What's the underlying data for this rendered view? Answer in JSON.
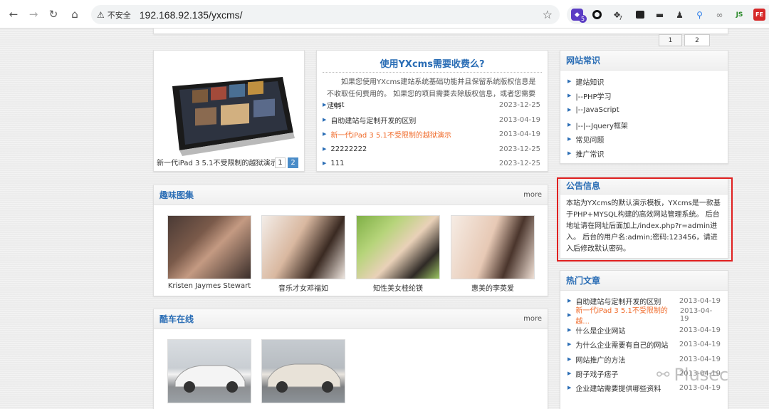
{
  "browser": {
    "security_label": "不安全",
    "url": "192.168.92.135/yxcms/",
    "extensions": [
      {
        "icon": "shield-ext-icon",
        "badge": "5"
      },
      {
        "icon": "ring-ext-icon"
      },
      {
        "icon": "code-ext-icon",
        "badge": "7"
      },
      {
        "icon": "panel-ext-icon"
      },
      {
        "icon": "hat-ext-icon"
      },
      {
        "icon": "spy-ext-icon"
      },
      {
        "icon": "pin-ext-icon"
      },
      {
        "icon": "link-ext-icon"
      },
      {
        "icon": "js-ext-icon",
        "label": "JS"
      },
      {
        "icon": "fe-ext-icon",
        "label": "FE"
      }
    ]
  },
  "pager": [
    "1",
    "2"
  ],
  "slideshow": {
    "caption": "新一代iPad 3 5.1不受限制的越狱演示",
    "pages": [
      "1",
      "2"
    ]
  },
  "feature": {
    "title": "使用YXcms需要收费么?",
    "desc": "如果您使用YXcms建站系统基础功能并且保留系统版权信息是不收取任何费用的。 如果您的项目需要去除版权信息，或者您需要定制",
    "articles": [
      {
        "title": "test",
        "date": "2023-12-25"
      },
      {
        "title": "自助建站与定制开发的区别",
        "date": "2013-04-19"
      },
      {
        "title": "新一代iPad 3 5.1不受限制的越狱演示",
        "date": "2013-04-19",
        "color": "#f06c2c"
      },
      {
        "title": "22222222",
        "date": "2023-12-25"
      },
      {
        "title": "111",
        "date": "2023-12-25"
      }
    ]
  },
  "gallery": {
    "title": "趣味图集",
    "more": "more",
    "photos": [
      {
        "caption": "Kristen Jaymes Stewart"
      },
      {
        "caption": "音乐才女邓福如"
      },
      {
        "caption": "知性美女桂纶镁"
      },
      {
        "caption": "惠美的李英爱"
      }
    ]
  },
  "cars": {
    "title": "酷车在线",
    "more": "more"
  },
  "sidebar": {
    "knowledge": {
      "title": "网站常识",
      "items": [
        "建站知识",
        "|--PHP学习",
        "|--JavaScript",
        "|--|--Jquery框架",
        "常见问题",
        "推广常识"
      ]
    },
    "notice": {
      "title": "公告信息",
      "text": "本站为YXcms的默认演示模板，YXcms是一款基于PHP+MYSQL构建的高效网站管理系统。 后台地址请在网址后面加上/index.php?r=admin进入。 后台的用户名:admin;密码:123456，请进入后修改默认密码。"
    },
    "hot": {
      "title": "热门文章",
      "items": [
        {
          "title": "自助建站与定制开发的区别",
          "date": "2013-04-19"
        },
        {
          "title": "新一代iPad 3 5.1不受限制的越...",
          "date": "2013-04-19",
          "color": "#f06c2c"
        },
        {
          "title": "什么是企业网站",
          "date": "2013-04-19"
        },
        {
          "title": "为什么企业需要有自己的网站",
          "date": "2013-04-19"
        },
        {
          "title": "网站推广的方法",
          "date": "2013-04-19"
        },
        {
          "title": "厨子戏子痞子",
          "date": "2013-04-19"
        },
        {
          "title": "企业建站需要提供哪些资料",
          "date": "2013-04-19"
        }
      ]
    }
  },
  "watermark": "Plusec",
  "colors": {
    "accent": "#2a6db5",
    "highlight": "#f06c2c",
    "callout": "#e02020"
  }
}
